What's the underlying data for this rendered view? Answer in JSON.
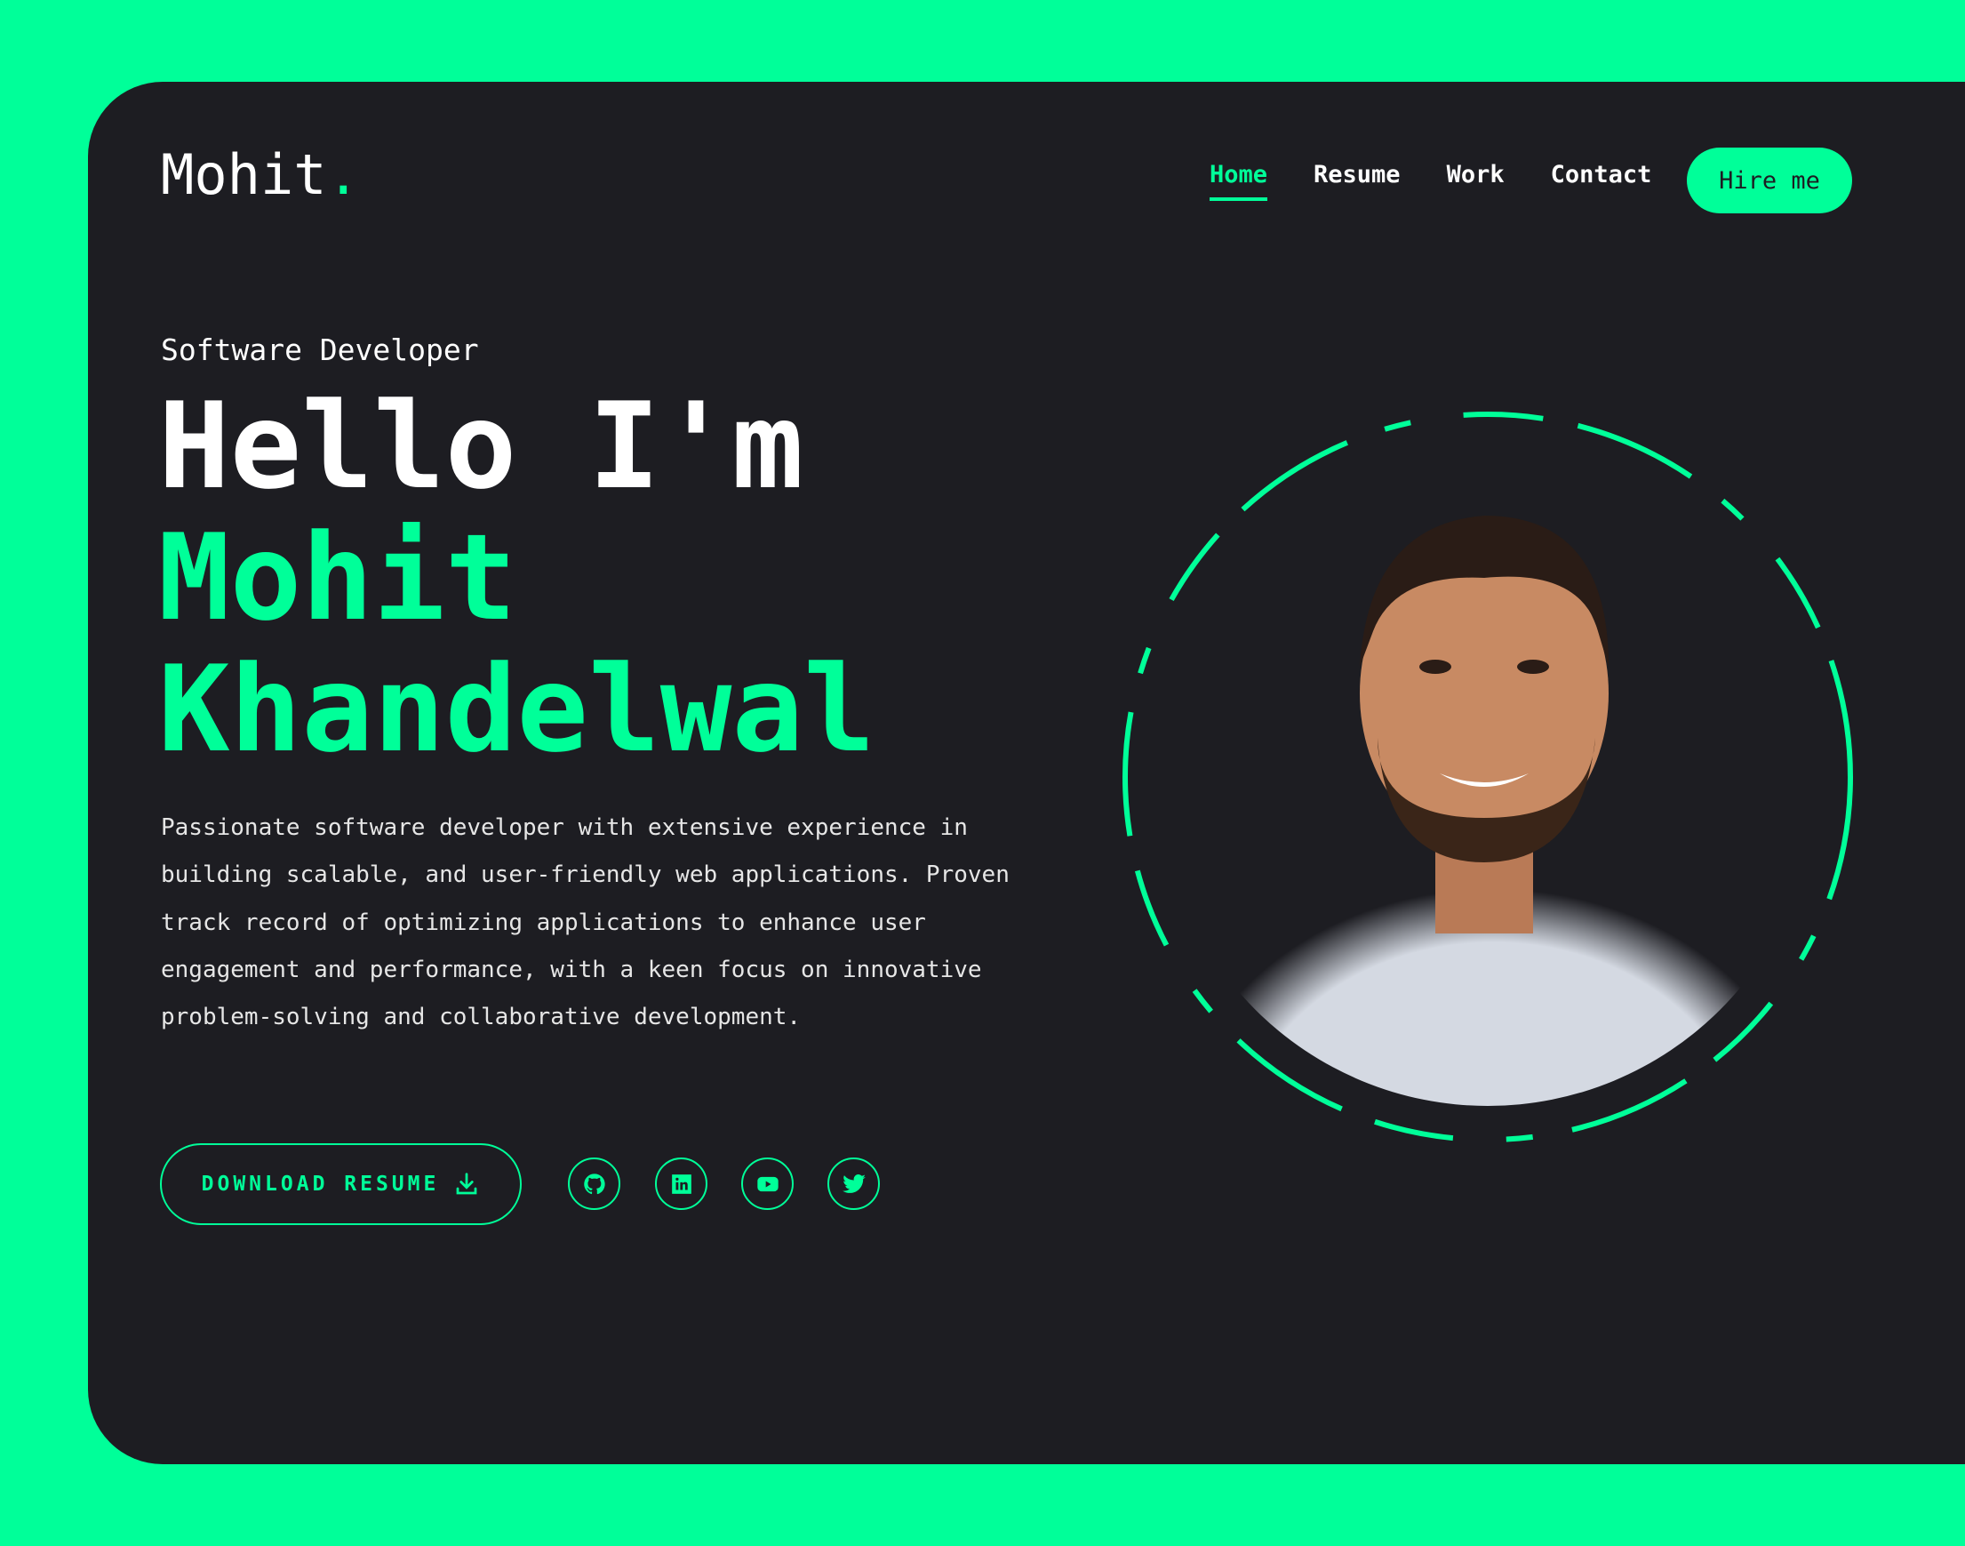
{
  "colors": {
    "accent": "#00ff99",
    "background": "#1d1d22",
    "text": "#ffffff"
  },
  "header": {
    "logo": "Mohit",
    "logo_dot": ".",
    "nav": [
      {
        "label": "Home",
        "active": true
      },
      {
        "label": "Resume"
      },
      {
        "label": "Work"
      },
      {
        "label": "Contact"
      }
    ],
    "hire_label": "Hire me"
  },
  "hero": {
    "subtitle": "Software Developer",
    "greeting": "Hello I'm",
    "name_first": "Mohit",
    "name_last": "Khandelwal",
    "description": "Passionate software developer with extensive experience in building scalable, and user-friendly web applications. Proven track record of optimizing applications to enhance user engagement and performance, with a keen focus on innovative problem-solving and collaborative development.",
    "download_label": "DOWNLOAD RESUME",
    "socials": [
      "github-icon",
      "linkedin-icon",
      "youtube-icon",
      "twitter-icon"
    ]
  }
}
